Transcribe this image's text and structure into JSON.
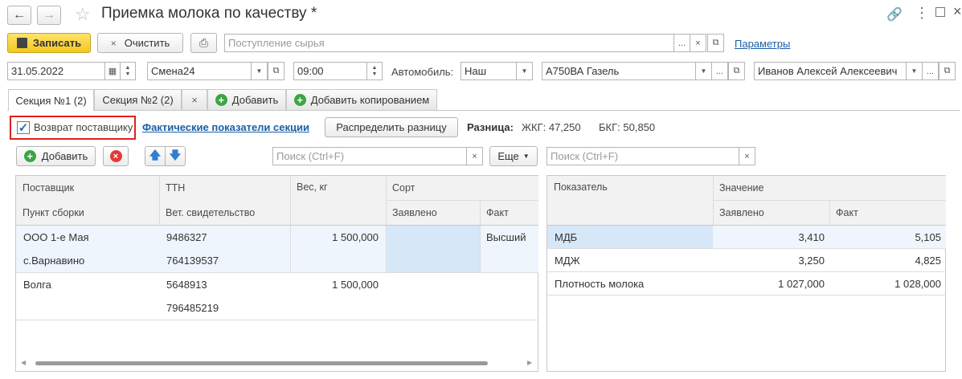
{
  "title": "Приемка молока по качеству *",
  "toolbar": {
    "save_label": "Записать",
    "clear_label": "Очистить",
    "source_placeholder": "Поступление сырья",
    "params_link": "Параметры",
    "ellipsis": "...",
    "close": "×"
  },
  "header_fields": {
    "date": "31.05.2022",
    "shift": "Смена24",
    "time": "09:00",
    "car_label": "Автомобиль:",
    "car_owner": "Наш",
    "car": "А750ВА Газель",
    "driver": "Иванов Алексей Алексеевич"
  },
  "tabs": [
    {
      "label": "Секция №1 (2)"
    },
    {
      "label": "Секция №2 (2)"
    },
    {
      "label": "×"
    },
    {
      "label": "Добавить"
    },
    {
      "label": "Добавить копированием"
    }
  ],
  "section": {
    "return_label": "Возврат поставщику",
    "return_checked": true,
    "actual_link": "Фактические показатели секции",
    "distribute_label": "Распределить разницу",
    "diff_label": "Разница:",
    "diff_zhkg": "ЖКГ: 47,250",
    "diff_bkg": "БКГ: 50,850"
  },
  "left_toolbar": {
    "add_label": "Добавить",
    "search_placeholder": "Поиск (Ctrl+F)",
    "more_label": "Еще"
  },
  "left_table": {
    "headers": {
      "supplier": "Поставщик",
      "point": "Пункт сборки",
      "ttn": "ТТН",
      "vet": "Вет. свидетельство",
      "weight": "Вес, кг",
      "grade": "Сорт",
      "declared": "Заявлено",
      "fact": "Факт"
    },
    "rows": [
      {
        "supplier": "ООО 1-е Мая",
        "point": "с.Варнавино",
        "ttn": "9486327",
        "vet": "764139537",
        "weight": "1 500,000",
        "declared": "",
        "fact": "Высший"
      },
      {
        "supplier": "Волга",
        "point": "",
        "ttn": "5648913",
        "vet": "796485219",
        "weight": "1 500,000",
        "declared": "",
        "fact": ""
      }
    ]
  },
  "right_toolbar": {
    "search_placeholder": "Поиск (Ctrl+F)"
  },
  "right_table": {
    "headers": {
      "indicator": "Показатель",
      "value": "Значение",
      "declared": "Заявлено",
      "fact": "Факт"
    },
    "rows": [
      {
        "indicator": "МДБ",
        "declared": "3,410",
        "fact": "5,105"
      },
      {
        "indicator": "МДЖ",
        "declared": "3,250",
        "fact": "4,825"
      },
      {
        "indicator": "Плотность молока",
        "declared": "1 027,000",
        "fact": "1 028,000"
      }
    ]
  },
  "colors": {
    "save_yellow": "#f5d233",
    "link_blue": "#1a5fa6",
    "selected_row": "#e8f1fb",
    "highlight_cell": "#d6e7f7",
    "checkbox_frame": "#e02020"
  }
}
